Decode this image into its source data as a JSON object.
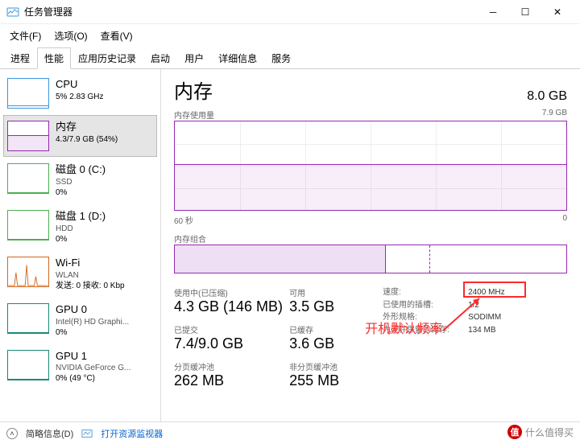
{
  "window": {
    "title": "任务管理器"
  },
  "menu": {
    "file": "文件(F)",
    "options": "选项(O)",
    "view": "查看(V)"
  },
  "tabs": [
    "进程",
    "性能",
    "应用历史记录",
    "启动",
    "用户",
    "详细信息",
    "服务"
  ],
  "sidebar": [
    {
      "title": "CPU",
      "sub": "",
      "val": "5% 2.83 GHz",
      "kind": "cpu"
    },
    {
      "title": "内存",
      "sub": "",
      "val": "4.3/7.9 GB (54%)",
      "kind": "mem",
      "active": true
    },
    {
      "title": "磁盘 0 (C:)",
      "sub": "SSD",
      "val": "0%",
      "kind": "disk"
    },
    {
      "title": "磁盘 1 (D:)",
      "sub": "HDD",
      "val": "0%",
      "kind": "disk"
    },
    {
      "title": "Wi-Fi",
      "sub": "WLAN",
      "val": "发送: 0 接收: 0 Kbp",
      "kind": "wifi"
    },
    {
      "title": "GPU 0",
      "sub": "Intel(R) HD Graphi...",
      "val": "0%",
      "kind": "gpu"
    },
    {
      "title": "GPU 1",
      "sub": "NVIDIA GeForce G...",
      "val": "0% (49 °C)",
      "kind": "gpu"
    }
  ],
  "memory": {
    "heading": "内存",
    "total": "8.0 GB",
    "usage_label": "内存使用量",
    "usage_max": "7.9 GB",
    "x_left": "60 秒",
    "x_right": "0",
    "comp_label": "内存组合",
    "stats": {
      "in_use_label": "使用中(已压缩)",
      "in_use": "4.3 GB (146 MB)",
      "available_label": "可用",
      "available": "3.5 GB",
      "committed_label": "已提交",
      "committed": "7.4/9.0 GB",
      "cached_label": "已缓存",
      "cached": "3.6 GB",
      "paged_label": "分页缓冲池",
      "paged": "262 MB",
      "nonpaged_label": "非分页缓冲池",
      "nonpaged": "255 MB"
    },
    "info": {
      "speed_k": "速度:",
      "speed_v": "2400 MHz",
      "slots_k": "已使用的插槽:",
      "slots_v": "1/2",
      "form_k": "外形规格:",
      "form_v": "SODIMM",
      "reserved_k": "为硬件保留的内存:",
      "reserved_v": "134 MB"
    }
  },
  "annotation": "开机默认频率",
  "footer": {
    "less": "简略信息(D)",
    "monitor": "打开资源监视器"
  },
  "watermark": "什么值得买"
}
